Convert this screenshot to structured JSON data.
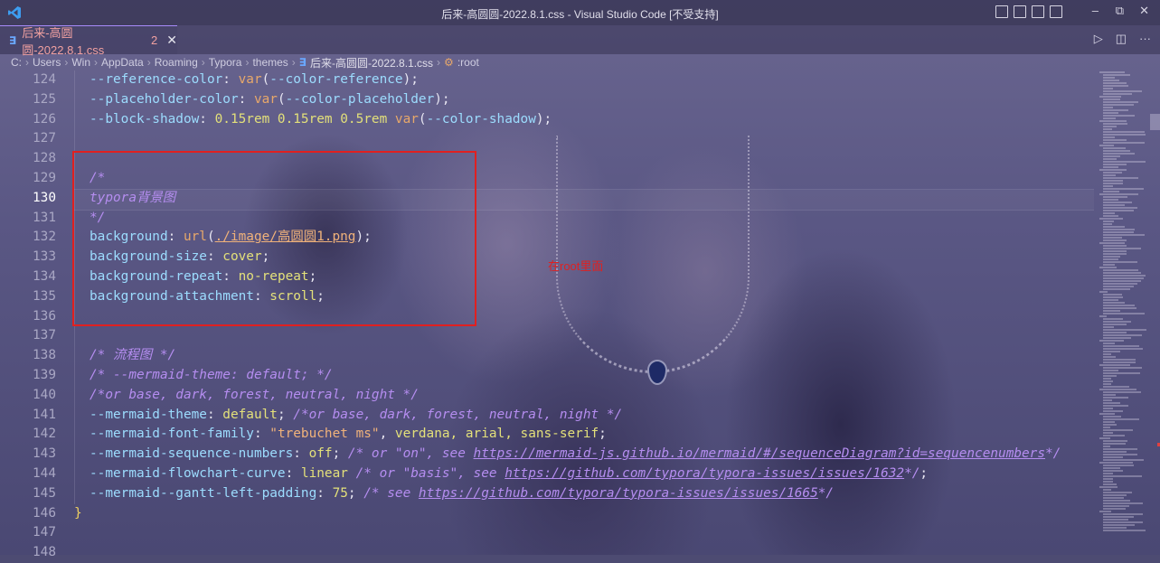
{
  "window": {
    "title": "后来-高圆圆-2022.8.1.css - Visual Studio Code [不受支持]",
    "controls": {
      "minimize": "–",
      "restore": "⧉",
      "close": "✕"
    }
  },
  "tab": {
    "label": "后来-高圆圆-2022.8.1.css",
    "badge": "2",
    "close": "✕",
    "file_icon": "css-file-icon"
  },
  "tab_actions": {
    "run": "▷",
    "split": "◫",
    "more": "···"
  },
  "breadcrumb": {
    "items": [
      "C:",
      "Users",
      "Win",
      "AppData",
      "Roaming",
      "Typora",
      "themes"
    ],
    "file": "后来-高圆圆-2022.8.1.css",
    "symbol": ":root"
  },
  "editor": {
    "active_line": 130,
    "lines": [
      {
        "n": "124"
      },
      {
        "n": "125"
      },
      {
        "n": "126"
      },
      {
        "n": "127"
      },
      {
        "n": "128"
      },
      {
        "n": "129"
      },
      {
        "n": "130"
      },
      {
        "n": "131"
      },
      {
        "n": "132"
      },
      {
        "n": "133"
      },
      {
        "n": "134"
      },
      {
        "n": "135"
      },
      {
        "n": "136"
      },
      {
        "n": "137"
      },
      {
        "n": "138"
      },
      {
        "n": "139"
      },
      {
        "n": "140"
      },
      {
        "n": "141"
      },
      {
        "n": "142"
      },
      {
        "n": "143"
      },
      {
        "n": "144"
      },
      {
        "n": "145"
      },
      {
        "n": "146"
      },
      {
        "n": "147"
      },
      {
        "n": "148"
      }
    ],
    "code": {
      "l124": {
        "p": "--reference-color",
        "f": "var",
        "a": "--color-reference"
      },
      "l125": {
        "p": "--placeholder-color",
        "f": "var",
        "a": "--color-placeholder"
      },
      "l126": {
        "p": "--block-shadow",
        "v": "0.15rem 0.15rem 0.5rem",
        "f": "var",
        "a": "--color-shadow"
      },
      "l129": {
        "c": "/*"
      },
      "l130": {
        "c": "typora背景图"
      },
      "l131": {
        "c": "*/"
      },
      "l132": {
        "p": "background",
        "f": "url",
        "a": "./image/高圆圆1.png"
      },
      "l133": {
        "p": "background-size",
        "v": "cover"
      },
      "l134": {
        "p": "background-repeat",
        "v": "no-repeat"
      },
      "l135": {
        "p": "background-attachment",
        "v": "scroll"
      },
      "l138": {
        "c": "/* 流程图 */"
      },
      "l139": {
        "c": "/* --mermaid-theme: default; */"
      },
      "l140": {
        "c": "/*or base, dark, forest, neutral, night */"
      },
      "l141": {
        "p": "--mermaid-theme",
        "v": "default",
        "c": "/*or base, dark, forest, neutral, night */"
      },
      "l142": {
        "p": "--mermaid-font-family",
        "s": "\"trebuchet ms\"",
        "v": "verdana, arial, sans-serif"
      },
      "l143": {
        "p": "--mermaid-sequence-numbers",
        "v": "off",
        "c1": "/* or \"on\", see ",
        "u": "https://mermaid-js.github.io/mermaid/#/sequenceDiagram?id=sequencenumbers",
        "c2": "*/"
      },
      "l144": {
        "p": "--mermaid-flowchart-curve",
        "v": "linear",
        "c1": "/* or \"basis\", see ",
        "u": "https://github.com/typora/typora-issues/issues/1632",
        "c2": "*/"
      },
      "l145": {
        "p": "--mermaid--gantt-left-padding",
        "v": "75",
        "c1": "/* see ",
        "u": "https://github.com/typora/typora-issues/issues/1665",
        "c2": "*/"
      },
      "l146": {
        "b": "}"
      }
    }
  },
  "annotation": {
    "text": "在root里面",
    "color": "#e02020"
  },
  "colors": {
    "accent": "#a78bfa",
    "highlight_box": "#e02020"
  }
}
